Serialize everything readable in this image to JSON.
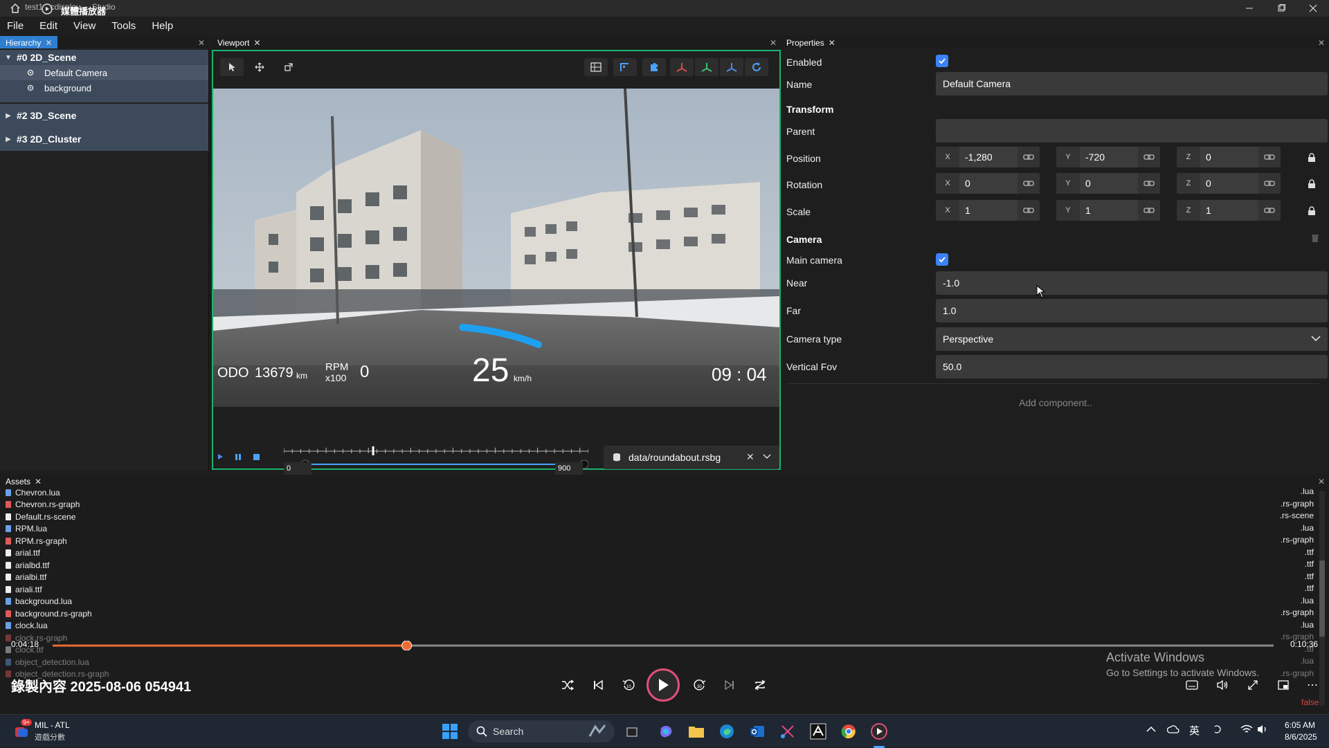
{
  "titlebar": {
    "app_title": "test1 - cdisplay ... Studio",
    "overlay_title": "媒體播放器"
  },
  "menu": [
    "File",
    "Edit",
    "View",
    "Tools",
    "Help"
  ],
  "hierarchy": {
    "tab_label": "Hierarchy",
    "scenes": [
      {
        "label": "#0 2D_Scene",
        "expanded": true,
        "children": [
          "Default Camera",
          "background"
        ]
      },
      {
        "label": "#2 3D_Scene",
        "expanded": false
      },
      {
        "label": "#3 2D_Cluster",
        "expanded": false
      }
    ]
  },
  "viewport": {
    "tab_label": "Viewport",
    "hud": {
      "odo_label": "ODO",
      "odo_value": "13679",
      "odo_unit": "km",
      "rpm_label": "RPM",
      "rpm_sub": "x100",
      "rpm_value": "0",
      "speed_value": "25",
      "speed_unit": "km/h",
      "clock": "09 : 04"
    },
    "playback": {
      "range_start": "0",
      "range_end": "900",
      "range_start_fraction": 0.07,
      "range_end_fraction": 1.0,
      "frame_fraction": 0.29,
      "file": "data/roundabout.rsbg"
    }
  },
  "properties": {
    "tab_label": "Properties",
    "enabled_label": "Enabled",
    "enabled_checked": true,
    "name_label": "Name",
    "name_value": "Default Camera",
    "transform_heading": "Transform",
    "parent_label": "Parent",
    "parent_value": "",
    "position_label": "Position",
    "position": {
      "x": "-1,280",
      "y": "-720",
      "z": "0"
    },
    "rotation_label": "Rotation",
    "rotation": {
      "x": "0",
      "y": "0",
      "z": "0"
    },
    "scale_label": "Scale",
    "scale": {
      "x": "1",
      "y": "1",
      "z": "1"
    },
    "camera_heading": "Camera",
    "main_camera_label": "Main camera",
    "main_camera_checked": true,
    "near_label": "Near",
    "near_value": "-1.0",
    "far_label": "Far",
    "far_value": "1.0",
    "camera_type_label": "Camera type",
    "camera_type_value": "Perspective",
    "vfov_label": "Vertical Fov",
    "vfov_value": "50.0",
    "add_component": "Add component.."
  },
  "assets": {
    "tab_label": "Assets",
    "files": [
      {
        "name": "Chevron.lua",
        "ext": ".lua",
        "color": "blue"
      },
      {
        "name": "Chevron.rs-graph",
        "ext": ".rs-graph",
        "color": "red"
      },
      {
        "name": "Default.rs-scene",
        "ext": ".rs-scene",
        "color": "white"
      },
      {
        "name": "RPM.lua",
        "ext": ".lua",
        "color": "blue"
      },
      {
        "name": "RPM.rs-graph",
        "ext": ".rs-graph",
        "color": "red"
      },
      {
        "name": "arial.ttf",
        "ext": ".ttf",
        "color": "white"
      },
      {
        "name": "arialbd.ttf",
        "ext": ".ttf",
        "color": "white"
      },
      {
        "name": "arialbi.ttf",
        "ext": ".ttf",
        "color": "white"
      },
      {
        "name": "ariali.ttf",
        "ext": ".ttf",
        "color": "white"
      },
      {
        "name": "background.lua",
        "ext": ".lua",
        "color": "blue"
      },
      {
        "name": "background.rs-graph",
        "ext": ".rs-graph",
        "color": "red"
      },
      {
        "name": "clock.lua",
        "ext": ".lua",
        "color": "blue"
      },
      {
        "name": "clock.rs-graph",
        "ext": ".rs-graph",
        "color": "red"
      },
      {
        "name": "clock.ttf",
        "ext": ".ttf",
        "color": "white"
      },
      {
        "name": "object_detection.lua",
        "ext": ".lua",
        "color": "blue"
      },
      {
        "name": "object_detection.rs-graph",
        "ext": ".rs-graph",
        "color": "red"
      }
    ]
  },
  "media_player": {
    "elapsed": "0:04:18",
    "duration": "0:10:36",
    "progress_fraction": 0.29,
    "title": "錄製內容 2025-08-06 054941",
    "activate_title": "Activate Windows",
    "activate_sub": "Go to Settings to activate Windows.",
    "stray_text": "false"
  },
  "taskbar": {
    "weather_title": "MIL - ATL",
    "weather_sub": "遊戲分數",
    "weather_badge": "9+",
    "search_placeholder": "Search",
    "ime": "英",
    "time": "6:05 AM",
    "date": "8/6/2025"
  },
  "colors": {
    "accent_blue": "#2f7fd0",
    "viewport_border": "#19b36b",
    "progress_orange": "#f06a35"
  }
}
